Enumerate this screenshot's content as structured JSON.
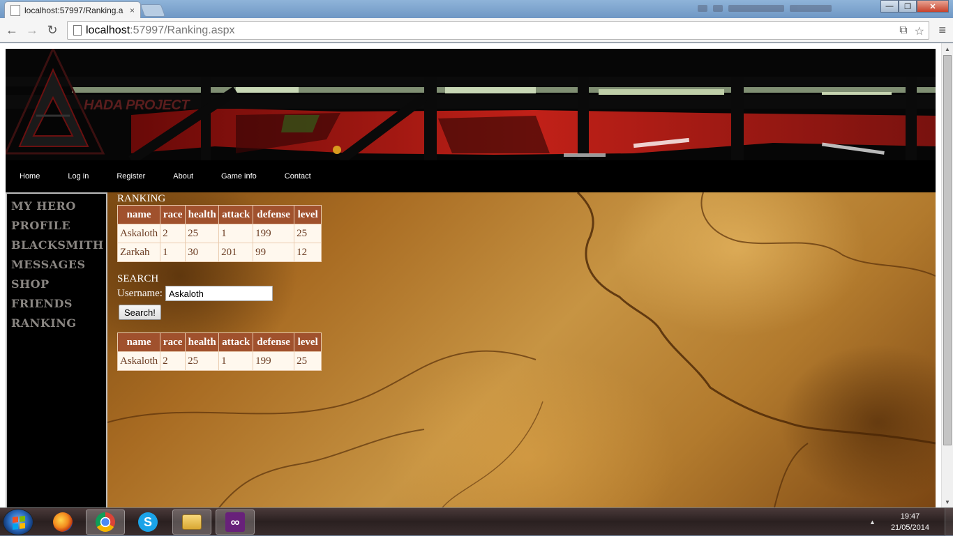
{
  "browser": {
    "tab_title": "localhost:57997/Ranking.a",
    "tab_close": "×",
    "url_host": "localhost",
    "url_path": ":57997/Ranking.aspx",
    "back_icon": "←",
    "forward_icon": "→",
    "reload_icon": "↻",
    "menu_icon": "≡",
    "bookmark_icon": "☆",
    "translate_icon": "⧉"
  },
  "site": {
    "logo_text": "HADA PROJECT",
    "nav": [
      "Home",
      "Log in",
      "Register",
      "About",
      "Game info",
      "Contact"
    ],
    "sidebar": [
      "MY HERO",
      "PROFILE",
      "BLACKSMITH",
      "MESSAGES",
      "SHOP",
      "FRIENDS",
      "RANKING"
    ]
  },
  "ranking": {
    "title": "RANKING",
    "columns": [
      "name",
      "race",
      "health",
      "attack",
      "defense",
      "level"
    ],
    "rows": [
      [
        "Askaloth",
        "2",
        "25",
        "1",
        "199",
        "25"
      ],
      [
        "Zarkah",
        "1",
        "30",
        "201",
        "99",
        "12"
      ]
    ]
  },
  "search": {
    "title": "SEARCH",
    "label": "Username:",
    "value": "Askaloth",
    "button": "Search!",
    "columns": [
      "name",
      "race",
      "health",
      "attack",
      "defense",
      "level"
    ],
    "rows": [
      [
        "Askaloth",
        "2",
        "25",
        "1",
        "199",
        "25"
      ]
    ]
  },
  "taskbar": {
    "time": "19:47",
    "date": "21/05/2014",
    "apps": [
      "firefox-icon",
      "chrome-icon",
      "skype-icon",
      "explorer-icon",
      "visual-studio-icon"
    ],
    "tray_arrow": "▲"
  },
  "colors": {
    "table_header": "#a0512d",
    "table_text": "#6b3c22",
    "sidebar_text": "#8a8682"
  }
}
